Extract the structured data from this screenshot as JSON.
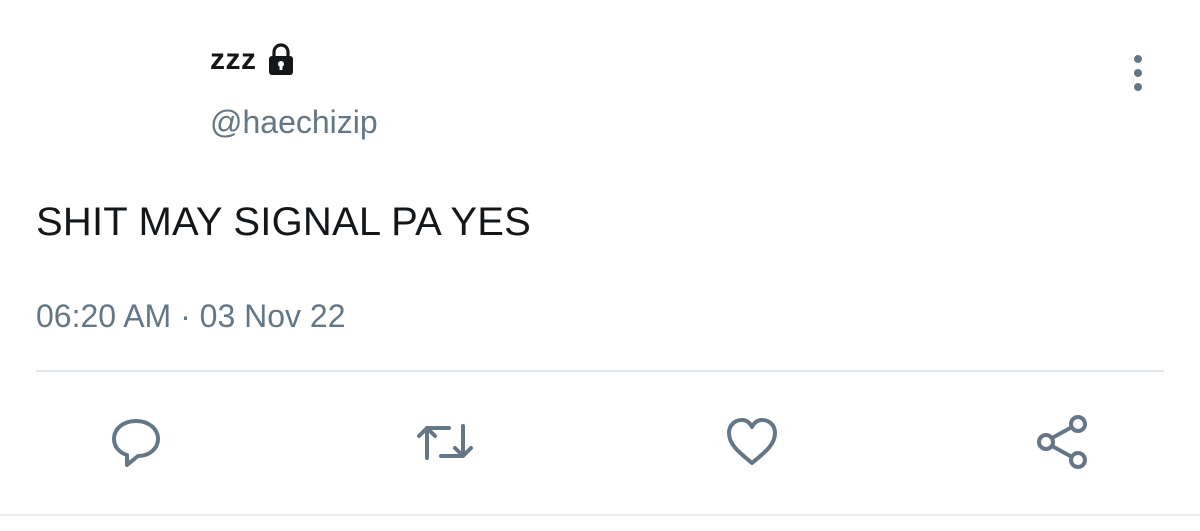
{
  "tweet": {
    "display_name": "zzz",
    "handle": "@haechizip",
    "text": "SHIT MAY SIGNAL PA YES",
    "timestamp": "06:20 AM · 03 Nov 22",
    "protected_icon": "lock-icon",
    "more_icon": "more-vertical-icon"
  },
  "actions": [
    {
      "name": "reply",
      "icon": "reply-icon"
    },
    {
      "name": "retweet",
      "icon": "retweet-icon"
    },
    {
      "name": "like",
      "icon": "heart-icon"
    },
    {
      "name": "share",
      "icon": "share-icon"
    }
  ],
  "colors": {
    "text": "#14171a",
    "secondary": "#657786",
    "divider": "#e1e8ed"
  }
}
